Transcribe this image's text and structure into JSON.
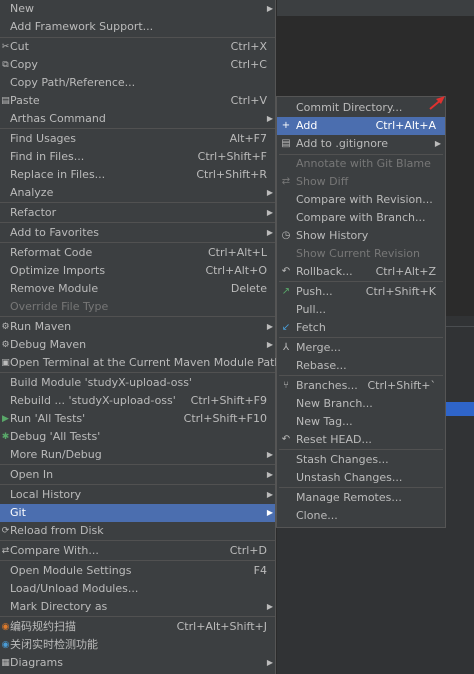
{
  "main_menu": {
    "items": [
      {
        "label": "New",
        "shortcut": "",
        "arrow": true
      },
      {
        "label": "Add Framework Support...",
        "shortcut": "",
        "arrow": false
      },
      {
        "label": "Cut",
        "shortcut": "Ctrl+X",
        "arrow": false,
        "icon": "✂"
      },
      {
        "label": "Copy",
        "shortcut": "Ctrl+C",
        "arrow": false,
        "icon": "⧉"
      },
      {
        "label": "Copy Path/Reference...",
        "shortcut": "",
        "arrow": false
      },
      {
        "label": "Paste",
        "shortcut": "Ctrl+V",
        "arrow": false,
        "icon": "▤"
      },
      {
        "label": "Arthas Command",
        "shortcut": "",
        "arrow": true
      },
      {
        "label": "Find Usages",
        "shortcut": "Alt+F7",
        "arrow": false
      },
      {
        "label": "Find in Files...",
        "shortcut": "Ctrl+Shift+F",
        "arrow": false
      },
      {
        "label": "Replace in Files...",
        "shortcut": "Ctrl+Shift+R",
        "arrow": false
      },
      {
        "label": "Analyze",
        "shortcut": "",
        "arrow": true
      },
      {
        "label": "Refactor",
        "shortcut": "",
        "arrow": true
      },
      {
        "label": "Add to Favorites",
        "shortcut": "",
        "arrow": true
      },
      {
        "label": "Reformat Code",
        "shortcut": "Ctrl+Alt+L",
        "arrow": false
      },
      {
        "label": "Optimize Imports",
        "shortcut": "Ctrl+Alt+O",
        "arrow": false
      },
      {
        "label": "Remove Module",
        "shortcut": "Delete",
        "arrow": false
      },
      {
        "label": "Override File Type",
        "shortcut": "",
        "arrow": false,
        "disabled": true
      },
      {
        "label": "Run Maven",
        "shortcut": "",
        "arrow": true,
        "icon": "⚙"
      },
      {
        "label": "Debug Maven",
        "shortcut": "",
        "arrow": true,
        "icon": "⚙"
      },
      {
        "label": "Open Terminal at the Current Maven Module Path",
        "shortcut": "",
        "arrow": false,
        "icon": "▣"
      },
      {
        "label": "Build Module 'studyX-upload-oss'",
        "shortcut": "",
        "arrow": false
      },
      {
        "label": "Rebuild ... 'studyX-upload-oss'",
        "shortcut": "Ctrl+Shift+F9",
        "arrow": false
      },
      {
        "label": "Run 'All Tests'",
        "shortcut": "Ctrl+Shift+F10",
        "arrow": false,
        "icon": "▶",
        "icon_color": "#59a869"
      },
      {
        "label": "Debug 'All Tests'",
        "shortcut": "",
        "arrow": false,
        "icon": "✱",
        "icon_color": "#59a869"
      },
      {
        "label": "More Run/Debug",
        "shortcut": "",
        "arrow": true
      },
      {
        "label": "Open In",
        "shortcut": "",
        "arrow": true
      },
      {
        "label": "Local History",
        "shortcut": "",
        "arrow": true
      },
      {
        "label": "Git",
        "shortcut": "",
        "arrow": true,
        "selected": true
      },
      {
        "label": "Reload from Disk",
        "shortcut": "",
        "arrow": false,
        "icon": "⟳"
      },
      {
        "label": "Compare With...",
        "shortcut": "Ctrl+D",
        "arrow": false,
        "icon": "⇄"
      },
      {
        "label": "Open Module Settings",
        "shortcut": "F4",
        "arrow": false
      },
      {
        "label": "Load/Unload Modules...",
        "shortcut": "",
        "arrow": false
      },
      {
        "label": "Mark Directory as",
        "shortcut": "",
        "arrow": true
      },
      {
        "label": "编码规约扫描",
        "shortcut": "Ctrl+Alt+Shift+J",
        "arrow": false,
        "icon": "◉",
        "icon_color": "#e07b2b"
      },
      {
        "label": "关闭实时检测功能",
        "shortcut": "",
        "arrow": false,
        "icon": "◉",
        "icon_color": "#4a9cd6"
      },
      {
        "label": "Diagrams",
        "shortcut": "",
        "arrow": true,
        "icon": "▦"
      }
    ]
  },
  "git_submenu": {
    "items": [
      {
        "label": "Commit Directory...",
        "shortcut": "",
        "arrow": false
      },
      {
        "label": "Add",
        "shortcut": "Ctrl+Alt+A",
        "arrow": false,
        "icon": "+",
        "selected": true
      },
      {
        "label": "Add to .gitignore",
        "shortcut": "",
        "arrow": true,
        "icon": "▤"
      },
      {
        "label": "Annotate with Git Blame",
        "shortcut": "",
        "arrow": false,
        "disabled": true
      },
      {
        "label": "Show Diff",
        "shortcut": "",
        "arrow": false,
        "disabled": true,
        "icon": "⇄"
      },
      {
        "label": "Compare with Revision...",
        "shortcut": "",
        "arrow": false
      },
      {
        "label": "Compare with Branch...",
        "shortcut": "",
        "arrow": false
      },
      {
        "label": "Show History",
        "shortcut": "",
        "arrow": false,
        "icon": "◷"
      },
      {
        "label": "Show Current Revision",
        "shortcut": "",
        "arrow": false,
        "disabled": true
      },
      {
        "label": "Rollback...",
        "shortcut": "Ctrl+Alt+Z",
        "arrow": false,
        "icon": "↶"
      },
      {
        "label": "Push...",
        "shortcut": "Ctrl+Shift+K",
        "arrow": false,
        "icon": "↗",
        "icon_color": "#59a869"
      },
      {
        "label": "Pull...",
        "shortcut": "",
        "arrow": false
      },
      {
        "label": "Fetch",
        "shortcut": "",
        "arrow": false,
        "icon": "↙",
        "icon_color": "#4a9cd6"
      },
      {
        "label": "Merge...",
        "shortcut": "",
        "arrow": false,
        "icon": "⅄"
      },
      {
        "label": "Rebase...",
        "shortcut": "",
        "arrow": false
      },
      {
        "label": "Branches...",
        "shortcut": "Ctrl+Shift+`",
        "arrow": false,
        "icon": "⑂"
      },
      {
        "label": "New Branch...",
        "shortcut": "",
        "arrow": false
      },
      {
        "label": "New Tag...",
        "shortcut": "",
        "arrow": false
      },
      {
        "label": "Reset HEAD...",
        "shortcut": "",
        "arrow": false,
        "icon": "↶"
      },
      {
        "label": "Stash Changes...",
        "shortcut": "",
        "arrow": false
      },
      {
        "label": "Unstash Changes...",
        "shortcut": "",
        "arrow": false
      },
      {
        "label": "Manage Remotes...",
        "shortcut": "",
        "arrow": false
      },
      {
        "label": "Clone...",
        "shortcut": "",
        "arrow": false
      }
    ]
  },
  "colors": {
    "menu_bg": "#3c3f41",
    "selection": "#4b6eaf",
    "text": "#bbbbbb",
    "disabled_text": "#777777",
    "annotation_arrow": "#e0312f"
  }
}
